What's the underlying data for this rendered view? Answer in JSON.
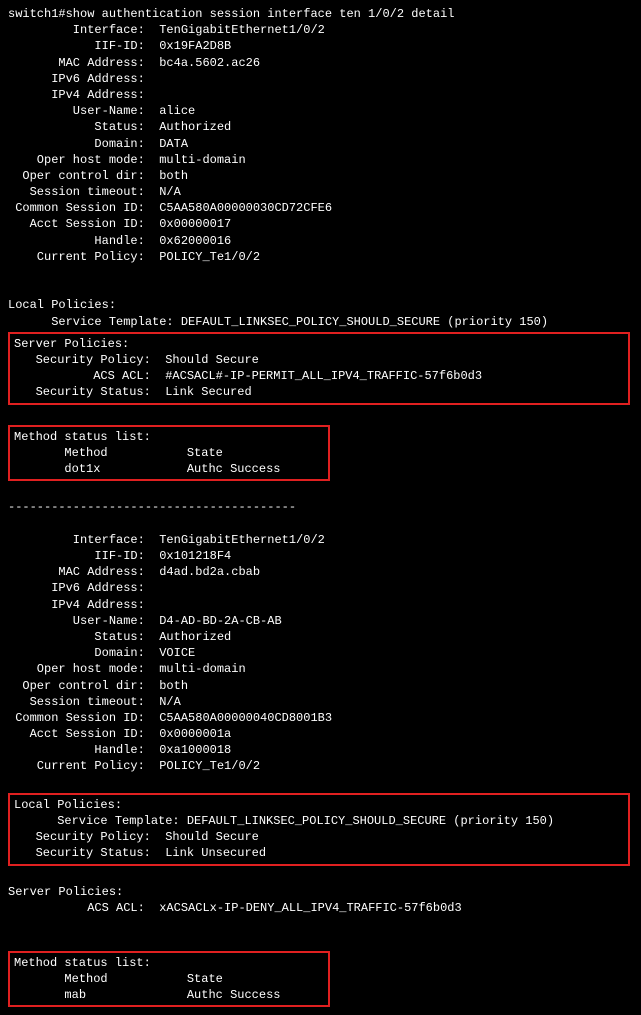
{
  "prompt": "switch1#",
  "command": "show authentication session interface ten 1/0/2 detail",
  "session1": {
    "interface": "TenGigabitEthernet1/0/2",
    "iif_id": "0x19FA2D8B",
    "mac": "bc4a.5602.ac26",
    "ipv6": "",
    "ipv4": "",
    "user": "alice",
    "status": "Authorized",
    "domain": "DATA",
    "oper_host_mode": "multi-domain",
    "oper_control_dir": "both",
    "session_timeout": "N/A",
    "common_session_id": "C5AA580A00000030CD72CFE6",
    "acct_session_id": "0x00000017",
    "handle": "0x62000016",
    "current_policy": "POLICY_Te1/0/2",
    "local_policies_header": "Local Policies:",
    "service_template": "DEFAULT_LINKSEC_POLICY_SHOULD_SECURE (priority 150)",
    "server_policies_header": "Server Policies:",
    "security_policy": "Should Secure",
    "acs_acl": "#ACSACL#-IP-PERMIT_ALL_IPV4_TRAFFIC-57f6b0d3",
    "security_status": "Link Secured",
    "method_header": "Method status list:",
    "method_col1": "Method",
    "method_col2": "State",
    "method_name": "dot1x",
    "method_state": "Authc Success"
  },
  "divider": "----------------------------------------",
  "session2": {
    "interface": "TenGigabitEthernet1/0/2",
    "iif_id": "0x101218F4",
    "mac": "d4ad.bd2a.cbab",
    "ipv6": "",
    "ipv4": "",
    "user": "D4-AD-BD-2A-CB-AB",
    "status": "Authorized",
    "domain": "VOICE",
    "oper_host_mode": "multi-domain",
    "oper_control_dir": "both",
    "session_timeout": "N/A",
    "common_session_id": "C5AA580A00000040CD8001B3",
    "acct_session_id": "0x0000001a",
    "handle": "0xa1000018",
    "current_policy": "POLICY_Te1/0/2",
    "local_policies_header": "Local Policies:",
    "service_template": "DEFAULT_LINKSEC_POLICY_SHOULD_SECURE (priority 150)",
    "security_policy": "Should Secure",
    "security_status": "Link Unsecured",
    "server_policies_header": "Server Policies:",
    "acs_acl": "xACSACLx-IP-DENY_ALL_IPV4_TRAFFIC-57f6b0d3",
    "method_header": "Method status list:",
    "method_col1": "Method",
    "method_col2": "State",
    "method_name": "mab",
    "method_state": "Authc Success"
  },
  "labels": {
    "interface": "         Interface:  ",
    "iif_id": "            IIF-ID:  ",
    "mac": "       MAC Address:  ",
    "ipv6": "      IPv6 Address:  ",
    "ipv4": "      IPv4 Address:  ",
    "user": "         User-Name:  ",
    "status": "            Status:  ",
    "domain": "            Domain:  ",
    "oper_host_mode": "    Oper host mode:  ",
    "oper_control_dir": "  Oper control dir:  ",
    "session_timeout": "   Session timeout:  ",
    "common_session_id": " Common Session ID:  ",
    "acct_session_id": "   Acct Session ID:  ",
    "handle": "            Handle:  ",
    "current_policy": "    Current Policy:  ",
    "service_template": "      Service Template: ",
    "security_policy": "   Security Policy:  ",
    "acs_acl": "           ACS ACL:  ",
    "security_status": "   Security Status:  ",
    "method_indent": "       ",
    "method_pad": "           "
  }
}
